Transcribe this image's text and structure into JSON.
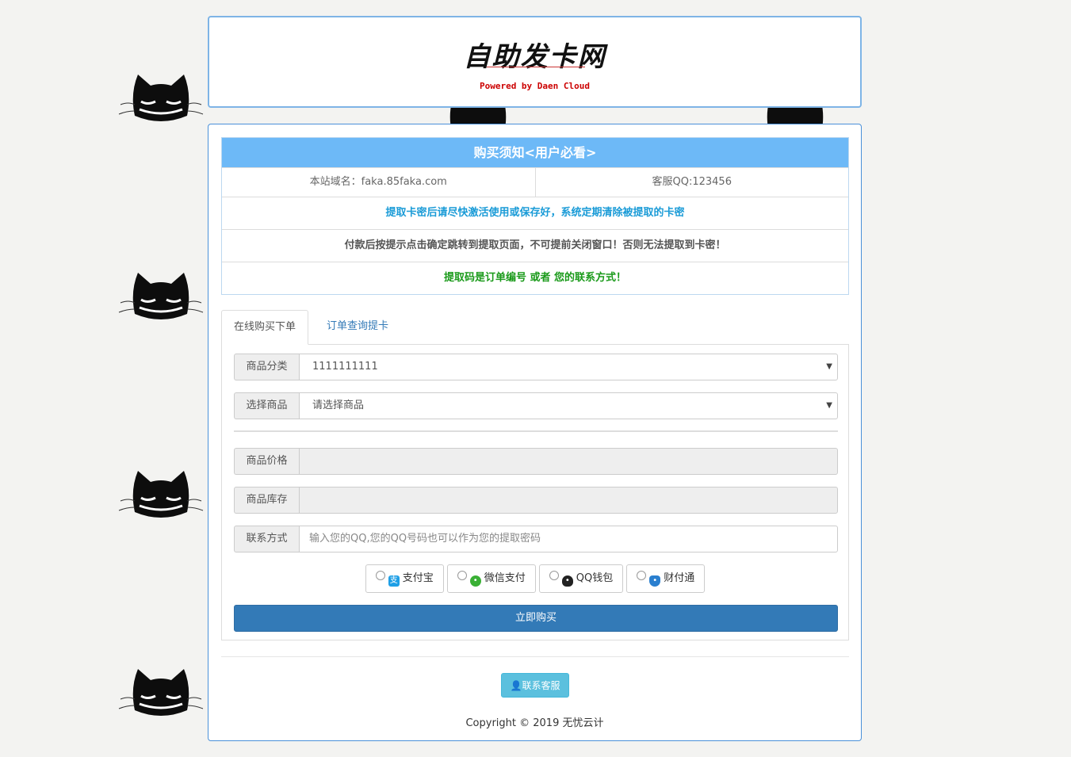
{
  "header": {
    "logo_text": "自助发卡网",
    "powered_by": "Powered by Daen Cloud"
  },
  "notice": {
    "title": "购买须知<用户必看>",
    "domain_label": "本站域名：faka.85faka.com",
    "qq_label": "客服QQ:123456",
    "lines": [
      {
        "text": "提取卡密后请尽快激活使用或保存好，系统定期清除被提取的卡密",
        "color": "#1a9bd7"
      },
      {
        "text": "付款后按提示点击确定跳转到提取页面，不可提前关闭窗口！否则无法提取到卡密！",
        "color": "#555555"
      },
      {
        "text": "提取码是订单编号 或者 您的联系方式！",
        "color": "#1a9a1a"
      }
    ]
  },
  "tabs": {
    "online_order": "在线购买下单",
    "order_query": "订单查询提卡"
  },
  "form": {
    "category_label": "商品分类",
    "category_value": "1111111111",
    "product_label": "选择商品",
    "product_value": "请选择商品",
    "price_label": "商品价格",
    "stock_label": "商品库存",
    "contact_label": "联系方式",
    "contact_placeholder": "输入您的QQ,您的QQ号码也可以作为您的提取密码"
  },
  "payment": {
    "alipay": "支付宝",
    "wechat": "微信支付",
    "qqwallet": "QQ钱包",
    "tenpay": "财付通"
  },
  "buy_button": "立即购买",
  "contact_button": "联系客服",
  "copyright": "Copyright © 2019 无忧云计",
  "colors": {
    "accent": "#337ab7",
    "notice_header": "#6db9f7",
    "panel_border": "#4a90d9",
    "info_button": "#5bc0de"
  }
}
